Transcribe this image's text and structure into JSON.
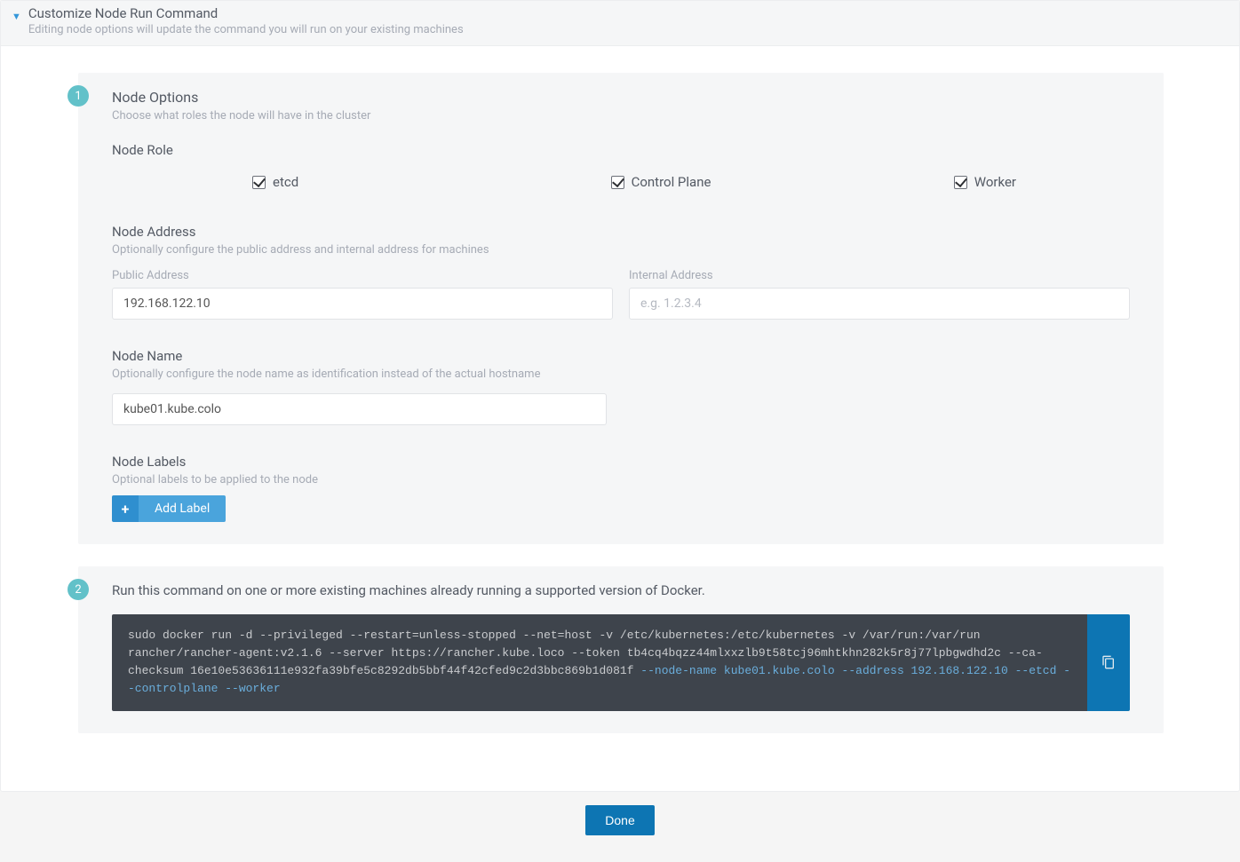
{
  "header": {
    "title": "Customize Node Run Command",
    "subtitle": "Editing node options will update the command you will run on your existing machines"
  },
  "step1": {
    "badge": "1",
    "title": "Node Options",
    "desc": "Choose what roles the node will have in the cluster",
    "role": {
      "label": "Node Role",
      "etcd": "etcd",
      "control_plane": "Control Plane",
      "worker": "Worker",
      "etcd_checked": true,
      "control_plane_checked": true,
      "worker_checked": true
    },
    "address": {
      "label": "Node Address",
      "desc": "Optionally configure the public address and internal address for machines",
      "public_label": "Public Address",
      "public_value": "192.168.122.10",
      "internal_label": "Internal Address",
      "internal_placeholder": "e.g. 1.2.3.4",
      "internal_value": ""
    },
    "name": {
      "label": "Node Name",
      "desc": "Optionally configure the node name as identification instead of the actual hostname",
      "value": "kube01.kube.colo"
    },
    "labels": {
      "label": "Node Labels",
      "desc": "Optional labels to be applied to the node",
      "button": "Add Label"
    }
  },
  "step2": {
    "badge": "2",
    "title": "Run this command on one or more existing machines already running a supported version of Docker.",
    "cmd_plain": "sudo docker run -d --privileged --restart=unless-stopped --net=host -v /etc/kubernetes:/etc/kubernetes -v /var/run:/var/run rancher/rancher-agent:v2.1.6 --server https://rancher.kube.loco --token tb4cq4bqzz44mlxxzlb9t58tcj96mhtkhn282k5r8j77lpbgwdhd2c --ca-checksum 16e10e53636111e932fa39bfe5c8292db5bbf44f42cfed9c2d3bbc869b1d081f --node-name kube01.kube.colo --address 192.168.122.10 --etcd --controlplane --worker",
    "cmd_parts": {
      "p1": "sudo docker run -d --privileged --restart=unless-stopped --net=host -v /etc/kubernetes:/etc/kubernetes -v /var/run:/var/run rancher/rancher-agent:v2.1.6 --server https://rancher.kube.loco --token tb4cq4bqzz44mlxxzlb9t58tcj96mhtkhn282k5r8j77lpbgwdhd2c --ca-checksum 16e10e53636111e932fa39bfe5c8292db5bbf44f42cfed9c2d3bbc869b1d081f ",
      "h1": "--node-name kube01.kube.colo",
      "p2": " ",
      "h2": "--address 192.168.122.10",
      "p3": " ",
      "h3": "--etcd --controlplane --worker"
    }
  },
  "footer": {
    "done": "Done"
  }
}
